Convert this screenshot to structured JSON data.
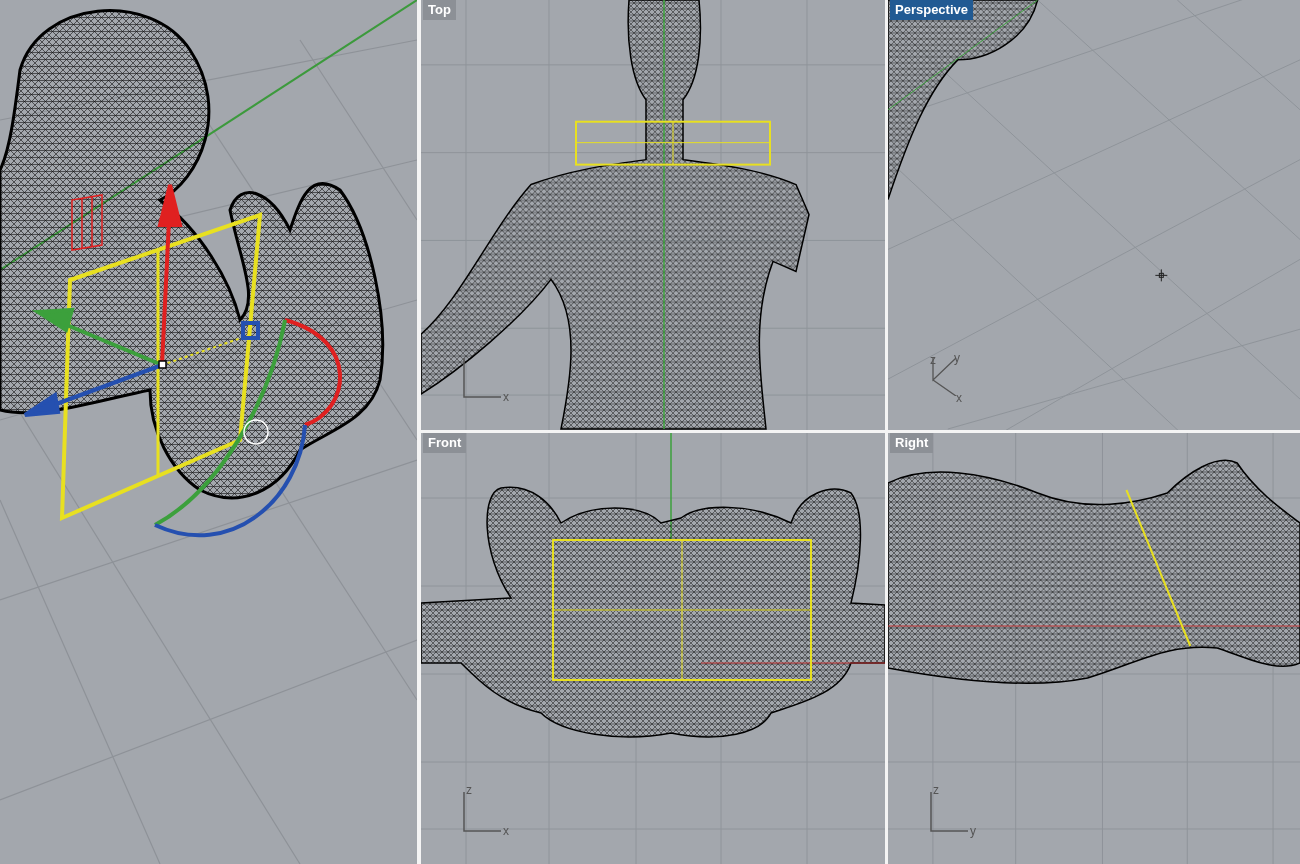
{
  "viewports": [
    {
      "kind": "top",
      "label": "Top",
      "selected": false,
      "axes": {
        "kind": "planar",
        "horizontal": "x"
      }
    },
    {
      "kind": "perspective",
      "label": "Perspective",
      "selected": true,
      "axes": {
        "kind": "tripod",
        "vertical": "z",
        "depth": "y",
        "horizontal": "x"
      }
    },
    {
      "kind": "front",
      "label": "Front",
      "selected": false,
      "axes": {
        "kind": "planar",
        "vertical": "z",
        "horizontal": "x"
      }
    },
    {
      "kind": "right",
      "label": "Right",
      "selected": false,
      "axes": {
        "kind": "planar",
        "vertical": "z",
        "horizontal": "y"
      }
    }
  ]
}
